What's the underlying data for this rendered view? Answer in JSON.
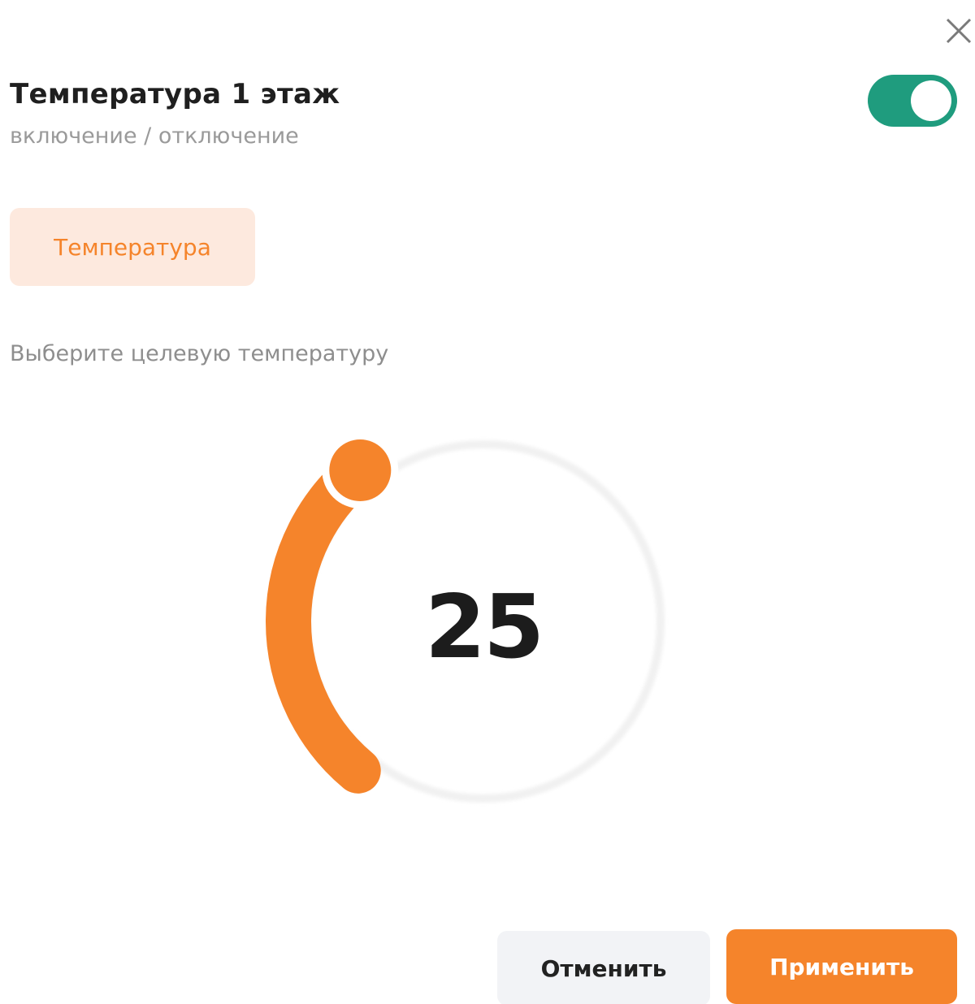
{
  "dialog": {
    "title": "Температура 1 этаж",
    "subtitle": "включение / отключение",
    "close_icon": "close-icon"
  },
  "power_toggle": {
    "state": "on",
    "color": "#1f9c7e"
  },
  "tabs": [
    {
      "label": "Температура",
      "selected": true
    }
  ],
  "target": {
    "prompt": "Выберите целевую температуру",
    "value": "25",
    "fill_fraction": 0.36,
    "accent_color": "#f5842b",
    "chip_background": "#fde9de"
  },
  "actions": {
    "cancel_label": "Отменить",
    "apply_label": "Применить"
  }
}
